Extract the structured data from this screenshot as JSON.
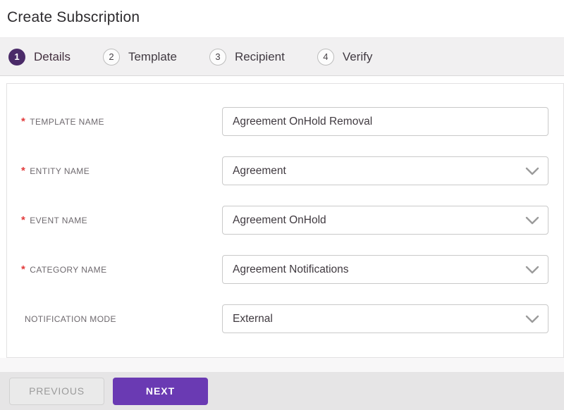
{
  "page_title": "Create Subscription",
  "stepper": {
    "steps": [
      {
        "number": "1",
        "label": "Details",
        "active": true
      },
      {
        "number": "2",
        "label": "Template",
        "active": false
      },
      {
        "number": "3",
        "label": "Recipient",
        "active": false
      },
      {
        "number": "4",
        "label": "Verify",
        "active": false
      }
    ]
  },
  "form": {
    "required_marker": "*",
    "fields": [
      {
        "label": "TEMPLATE NAME",
        "required": true,
        "type": "text",
        "value": "Agreement OnHold Removal"
      },
      {
        "label": "ENTITY NAME",
        "required": true,
        "type": "select",
        "value": "Agreement"
      },
      {
        "label": "EVENT NAME",
        "required": true,
        "type": "select",
        "value": "Agreement OnHold"
      },
      {
        "label": "CATEGORY NAME",
        "required": true,
        "type": "select",
        "value": "Agreement Notifications"
      },
      {
        "label": "NOTIFICATION MODE",
        "required": false,
        "type": "select",
        "value": "External"
      }
    ]
  },
  "footer": {
    "previous_label": "PREVIOUS",
    "next_label": "NEXT"
  },
  "colors": {
    "accent_purple": "#6a3ab3",
    "active_step_purple": "#4a2a68",
    "required_red": "#e23b3c",
    "stepper_bg": "#f1f0f1",
    "footer_bg": "#e6e5e6"
  }
}
